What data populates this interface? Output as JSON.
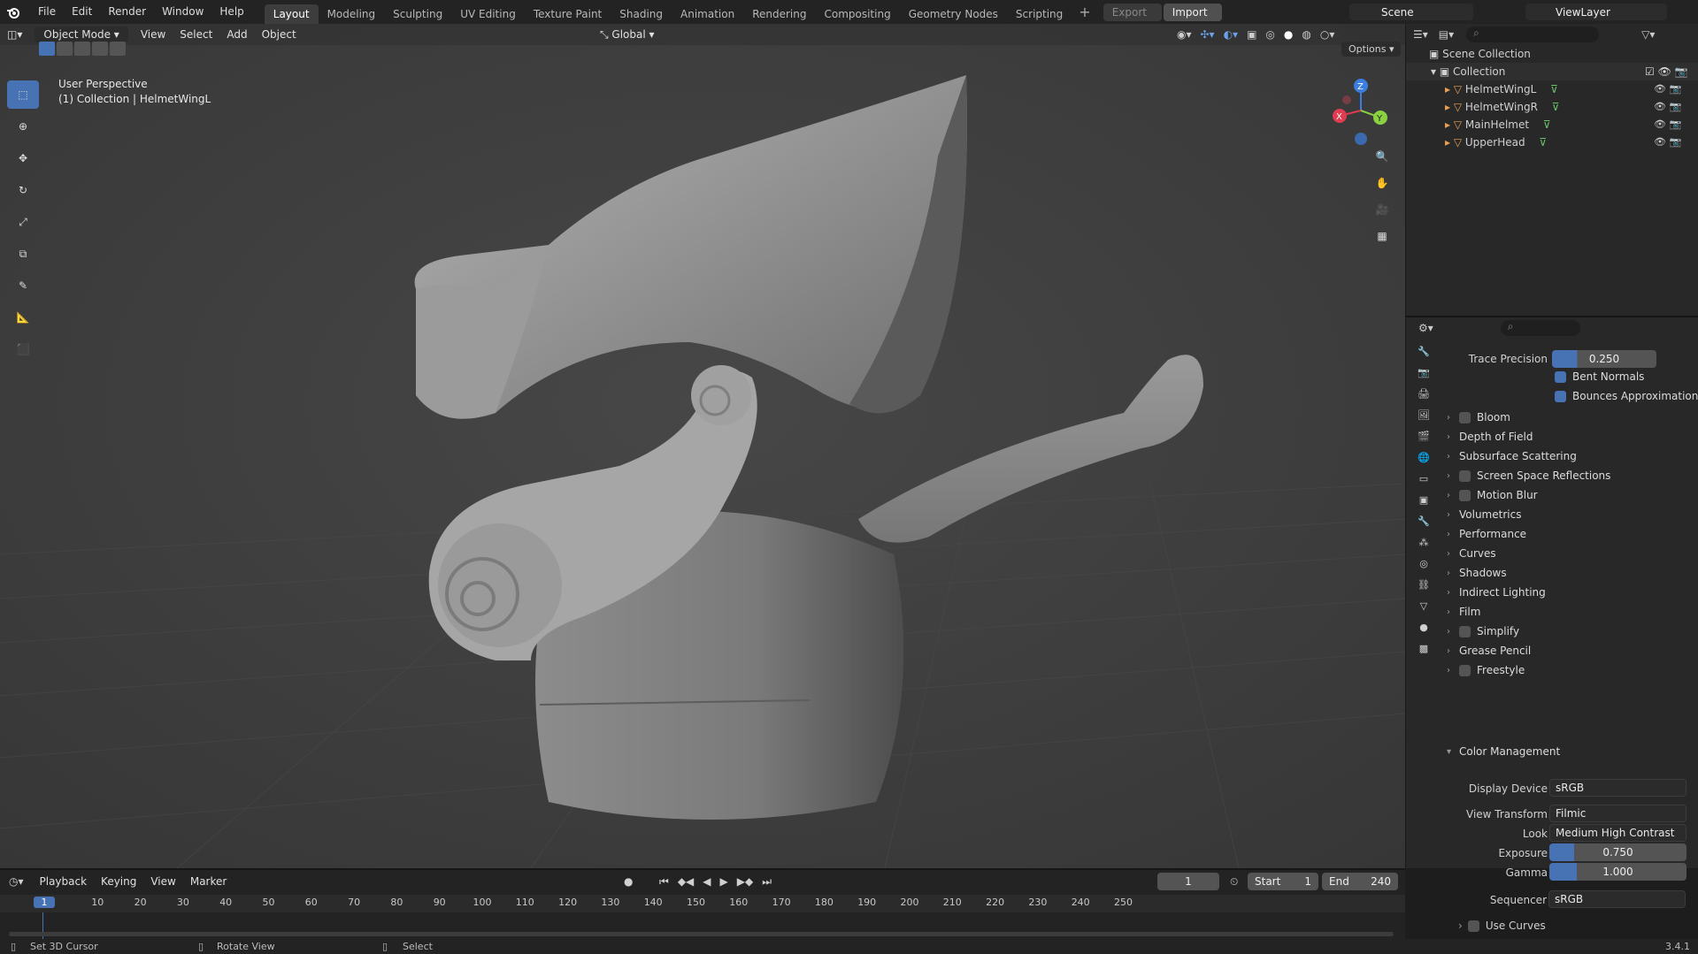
{
  "top_menu": [
    "File",
    "Edit",
    "Render",
    "Window",
    "Help"
  ],
  "workspaces": [
    "Layout",
    "Modeling",
    "Sculpting",
    "UV Editing",
    "Texture Paint",
    "Shading",
    "Animation",
    "Rendering",
    "Compositing",
    "Geometry Nodes",
    "Scripting"
  ],
  "export_label": "Export",
  "import_label": "Import",
  "scene_name": "Scene",
  "view_layer": "ViewLayer",
  "viewport": {
    "mode": "Object Mode",
    "menus": [
      "View",
      "Select",
      "Add",
      "Object"
    ],
    "transform": "Global",
    "options": "Options",
    "perspective": "User Perspective",
    "collection_info": "(1) Collection | HelmetWingL"
  },
  "outliner": {
    "root": "Scene Collection",
    "collection": "Collection",
    "items": [
      "HelmetWingL",
      "HelmetWingR",
      "MainHelmet",
      "UpperHead"
    ]
  },
  "props": {
    "trace_precision_label": "Trace Precision",
    "trace_precision": "0.250",
    "bent_normals": "Bent Normals",
    "bounces_approx": "Bounces Approximation",
    "sections": [
      "Bloom",
      "Depth of Field",
      "Subsurface Scattering",
      "Screen Space Reflections",
      "Motion Blur",
      "Volumetrics",
      "Performance",
      "Curves",
      "Shadows",
      "Indirect Lighting",
      "Film",
      "Simplify",
      "Grease Pencil",
      "Freestyle"
    ],
    "color_mgmt": "Color Management",
    "display_device_label": "Display Device",
    "display_device": "sRGB",
    "view_transform_label": "View Transform",
    "view_transform": "Filmic",
    "look_label": "Look",
    "look": "Medium High Contrast",
    "exposure_label": "Exposure",
    "exposure": "0.750",
    "gamma_label": "Gamma",
    "gamma": "1.000",
    "sequencer_label": "Sequencer",
    "sequencer": "sRGB",
    "use_curves": "Use Curves"
  },
  "timeline": {
    "menus": [
      "Playback",
      "Keying",
      "View",
      "Marker"
    ],
    "current_frame": "1",
    "start_label": "Start",
    "start": "1",
    "end_label": "End",
    "end": "240",
    "ticks": [
      "1",
      "10",
      "20",
      "30",
      "40",
      "50",
      "60",
      "70",
      "80",
      "90",
      "100",
      "110",
      "120",
      "130",
      "140",
      "150",
      "160",
      "170",
      "180",
      "190",
      "200",
      "210",
      "220",
      "230",
      "240",
      "250"
    ]
  },
  "status": {
    "left": "Set 3D Cursor",
    "mid": "Rotate View",
    "right": "Select",
    "version": "3.4.1"
  },
  "colors": {
    "accent": "#4772b3",
    "axis_x": "#e03c50",
    "axis_y": "#8ad142",
    "axis_z": "#3c7ee0"
  }
}
